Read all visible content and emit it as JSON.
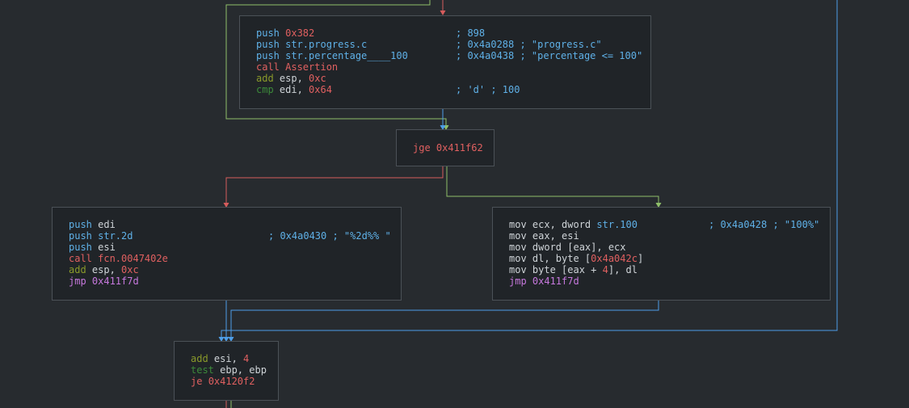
{
  "colors": {
    "background": "#272b2f",
    "node_bg": "#202428",
    "node_border": "#4b5157",
    "edge_true": "#8fbf6a",
    "edge_false": "#d65c5c",
    "edge_jump": "#4e9ee8"
  },
  "nodes": [
    {
      "id": "block-assert",
      "lines": [
        {
          "parts": [
            {
              "t": "push ",
              "c": "#5fb1e8"
            },
            {
              "t": "0x382",
              "c": "#e06060"
            }
          ],
          "comment": "; 898"
        },
        {
          "parts": [
            {
              "t": "push ",
              "c": "#5fb1e8"
            },
            {
              "t": "str.progress.c",
              "c": "#5fb1e8"
            }
          ],
          "comment": "; 0x4a0288 ; \"progress.c\""
        },
        {
          "parts": [
            {
              "t": "push ",
              "c": "#5fb1e8"
            },
            {
              "t": "str.percentage____100",
              "c": "#5fb1e8"
            }
          ],
          "comment": "; 0x4a0438 ; \"percentage <= 100\""
        },
        {
          "parts": [
            {
              "t": "call ",
              "c": "#e06060"
            },
            {
              "t": "Assertion",
              "c": "#e06060"
            }
          ],
          "comment": ""
        },
        {
          "parts": [
            {
              "t": "add ",
              "c": "#8a9a2a"
            },
            {
              "t": "esp",
              "c": "#cfd4d8"
            },
            {
              "t": ", ",
              "c": "#cfd4d8"
            },
            {
              "t": "0xc",
              "c": "#e06060"
            }
          ],
          "comment": ""
        },
        {
          "parts": [
            {
              "t": "cmp ",
              "c": "#3c8a3a"
            },
            {
              "t": "edi",
              "c": "#cfd4d8"
            },
            {
              "t": ", ",
              "c": "#cfd4d8"
            },
            {
              "t": "0x64",
              "c": "#e06060"
            }
          ],
          "comment": "; 'd' ; 100"
        }
      ]
    },
    {
      "id": "block-jge",
      "lines": [
        {
          "parts": [
            {
              "t": "jge ",
              "c": "#e06060"
            },
            {
              "t": "0x411f62",
              "c": "#e06060"
            }
          ],
          "comment": ""
        }
      ]
    },
    {
      "id": "block-left",
      "lines": [
        {
          "parts": [
            {
              "t": "push ",
              "c": "#5fb1e8"
            },
            {
              "t": "edi",
              "c": "#cfd4d8"
            }
          ],
          "comment": ""
        },
        {
          "parts": [
            {
              "t": "push ",
              "c": "#5fb1e8"
            },
            {
              "t": "str.2d",
              "c": "#5fb1e8"
            }
          ],
          "comment": "; 0x4a0430 ; \"%2d%% \""
        },
        {
          "parts": [
            {
              "t": "push ",
              "c": "#5fb1e8"
            },
            {
              "t": "esi",
              "c": "#cfd4d8"
            }
          ],
          "comment": ""
        },
        {
          "parts": [
            {
              "t": "call ",
              "c": "#e06060"
            },
            {
              "t": "fcn.0047402e",
              "c": "#e06060"
            }
          ],
          "comment": ""
        },
        {
          "parts": [
            {
              "t": "add ",
              "c": "#8a9a2a"
            },
            {
              "t": "esp",
              "c": "#cfd4d8"
            },
            {
              "t": ", ",
              "c": "#cfd4d8"
            },
            {
              "t": "0xc",
              "c": "#e06060"
            }
          ],
          "comment": ""
        },
        {
          "parts": [
            {
              "t": "jmp ",
              "c": "#c678dd"
            },
            {
              "t": "0x411f7d",
              "c": "#c678dd"
            }
          ],
          "comment": ""
        }
      ]
    },
    {
      "id": "block-right",
      "lines": [
        {
          "parts": [
            {
              "t": "mov ",
              "c": "#cfd4d8"
            },
            {
              "t": "ecx, dword ",
              "c": "#cfd4d8"
            },
            {
              "t": "str.100",
              "c": "#5fb1e8"
            }
          ],
          "comment": "; 0x4a0428 ; \"100%\""
        },
        {
          "parts": [
            {
              "t": "mov ",
              "c": "#cfd4d8"
            },
            {
              "t": "eax, esi",
              "c": "#cfd4d8"
            }
          ],
          "comment": ""
        },
        {
          "parts": [
            {
              "t": "mov ",
              "c": "#cfd4d8"
            },
            {
              "t": "dword [eax], ecx",
              "c": "#cfd4d8"
            }
          ],
          "comment": ""
        },
        {
          "parts": [
            {
              "t": "mov ",
              "c": "#cfd4d8"
            },
            {
              "t": "dl, byte [",
              "c": "#cfd4d8"
            },
            {
              "t": "0x4a042c",
              "c": "#e06060"
            },
            {
              "t": "]",
              "c": "#cfd4d8"
            }
          ],
          "comment": ""
        },
        {
          "parts": [
            {
              "t": "mov ",
              "c": "#cfd4d8"
            },
            {
              "t": "byte [eax + ",
              "c": "#cfd4d8"
            },
            {
              "t": "4",
              "c": "#e06060"
            },
            {
              "t": "], dl",
              "c": "#cfd4d8"
            }
          ],
          "comment": ""
        },
        {
          "parts": [
            {
              "t": "jmp ",
              "c": "#c678dd"
            },
            {
              "t": "0x411f7d",
              "c": "#c678dd"
            }
          ],
          "comment": ""
        }
      ]
    },
    {
      "id": "block-bottom",
      "lines": [
        {
          "parts": [
            {
              "t": "add ",
              "c": "#8a9a2a"
            },
            {
              "t": "esi",
              "c": "#cfd4d8"
            },
            {
              "t": ", ",
              "c": "#cfd4d8"
            },
            {
              "t": "4",
              "c": "#e06060"
            }
          ],
          "comment": ""
        },
        {
          "parts": [
            {
              "t": "test ",
              "c": "#3c8a3a"
            },
            {
              "t": "ebp, ebp",
              "c": "#cfd4d8"
            }
          ],
          "comment": ""
        },
        {
          "parts": [
            {
              "t": "je ",
              "c": "#e06060"
            },
            {
              "t": "0x4120f2",
              "c": "#e06060"
            }
          ],
          "comment": ""
        }
      ]
    }
  ]
}
